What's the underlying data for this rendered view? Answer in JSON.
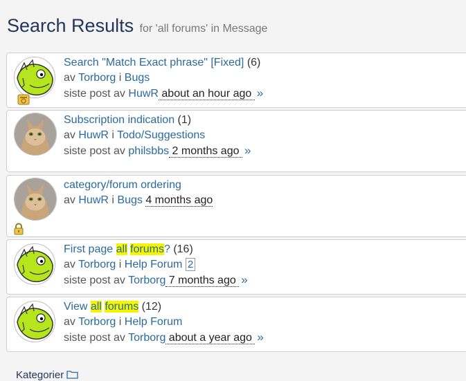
{
  "page": {
    "title": "Search Results",
    "subtitle": "for 'all forums' in Message"
  },
  "labels": {
    "by": "av",
    "in": "i",
    "last_post_by": "siste post av",
    "chevron": "»"
  },
  "results": [
    {
      "title": "Search \"Match Exact phrase\" [Fixed]",
      "count": "(6)",
      "author": "Torborg",
      "forum": "Bugs",
      "last_poster": "HuwR",
      "time": " about an hour ago ",
      "avatar": "dino",
      "status_icon": "topic-icon"
    },
    {
      "title": "Subscription indication",
      "count": "(1)",
      "author": "HuwR",
      "forum": "Todo/Suggestions",
      "last_poster": "philsbbs",
      "time": " 2 months ago ",
      "avatar": "cat"
    },
    {
      "title": "category/forum ordering",
      "author": "HuwR",
      "forum": "Bugs",
      "time": " 4 months ago ",
      "avatar": "cat",
      "status_icon": "lock-icon"
    },
    {
      "title_parts": [
        "First page ",
        "all",
        " ",
        "forums",
        "?"
      ],
      "count": "(16)",
      "author": "Torborg",
      "forum": "Help Forum",
      "page_link": "2",
      "last_poster": "Torborg",
      "time": " 7 months ago ",
      "avatar": "dino"
    },
    {
      "title_parts": [
        "View ",
        "all",
        " ",
        "forums"
      ],
      "count": "(12)",
      "author": "Torborg",
      "forum": "Help Forum",
      "last_poster": "Torborg",
      "time": " about a year ago ",
      "avatar": "dino"
    }
  ],
  "footer": {
    "label": "Kategorier"
  }
}
